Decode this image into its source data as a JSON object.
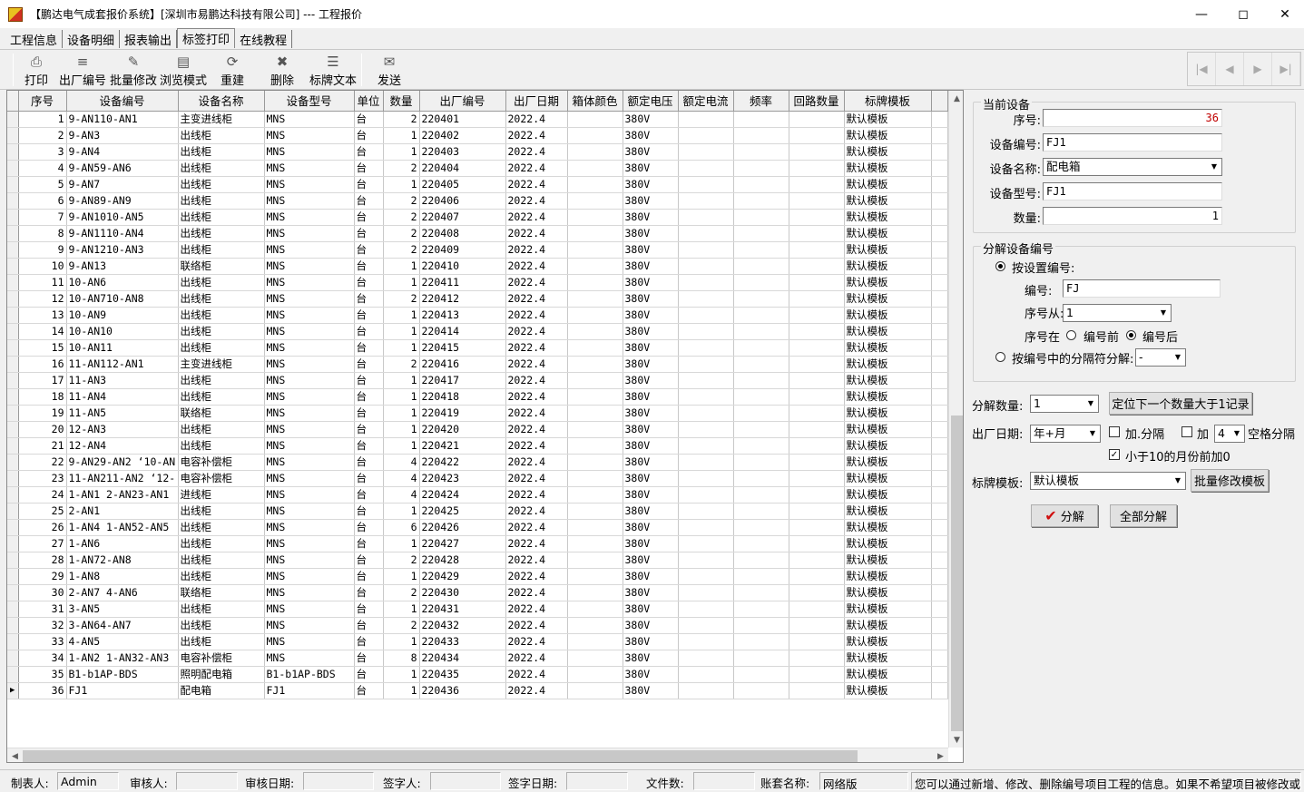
{
  "window": {
    "title": "【鹏达电气成套报价系统】[深圳市易鹏达科技有限公司] --- 工程报价"
  },
  "tabs": [
    "工程信息",
    "设备明细",
    "报表输出",
    "标签打印",
    "在线教程"
  ],
  "toolbar": {
    "buttons": [
      "打印",
      "出厂编号",
      "批量修改",
      "浏览模式",
      "重建",
      "删除",
      "标牌文本",
      "发送"
    ]
  },
  "grid": {
    "columns": [
      "序号",
      "设备编号",
      "设备名称",
      "设备型号",
      "单位",
      "数量",
      "出厂编号",
      "出厂日期",
      "箱体颜色",
      "额定电压",
      "额定电流",
      "频率",
      "回路数量",
      "标牌模板"
    ],
    "rows": [
      [
        "1",
        "9-AN110-AN1",
        "主变进线柜",
        "MNS",
        "台",
        "2",
        "220401",
        "2022.4",
        "",
        "380V",
        "",
        "",
        "",
        "默认模板"
      ],
      [
        "2",
        "9-AN3",
        "出线柜",
        "MNS",
        "台",
        "1",
        "220402",
        "2022.4",
        "",
        "380V",
        "",
        "",
        "",
        "默认模板"
      ],
      [
        "3",
        "9-AN4",
        "出线柜",
        "MNS",
        "台",
        "1",
        "220403",
        "2022.4",
        "",
        "380V",
        "",
        "",
        "",
        "默认模板"
      ],
      [
        "4",
        "9-AN59-AN6",
        "出线柜",
        "MNS",
        "台",
        "2",
        "220404",
        "2022.4",
        "",
        "380V",
        "",
        "",
        "",
        "默认模板"
      ],
      [
        "5",
        "9-AN7",
        "出线柜",
        "MNS",
        "台",
        "1",
        "220405",
        "2022.4",
        "",
        "380V",
        "",
        "",
        "",
        "默认模板"
      ],
      [
        "6",
        "9-AN89-AN9",
        "出线柜",
        "MNS",
        "台",
        "2",
        "220406",
        "2022.4",
        "",
        "380V",
        "",
        "",
        "",
        "默认模板"
      ],
      [
        "7",
        "9-AN1010-AN5",
        "出线柜",
        "MNS",
        "台",
        "2",
        "220407",
        "2022.4",
        "",
        "380V",
        "",
        "",
        "",
        "默认模板"
      ],
      [
        "8",
        "9-AN1110-AN4",
        "出线柜",
        "MNS",
        "台",
        "2",
        "220408",
        "2022.4",
        "",
        "380V",
        "",
        "",
        "",
        "默认模板"
      ],
      [
        "9",
        "9-AN1210-AN3",
        "出线柜",
        "MNS",
        "台",
        "2",
        "220409",
        "2022.4",
        "",
        "380V",
        "",
        "",
        "",
        "默认模板"
      ],
      [
        "10",
        "9-AN13",
        "联络柜",
        "MNS",
        "台",
        "1",
        "220410",
        "2022.4",
        "",
        "380V",
        "",
        "",
        "",
        "默认模板"
      ],
      [
        "11",
        "10-AN6",
        "出线柜",
        "MNS",
        "台",
        "1",
        "220411",
        "2022.4",
        "",
        "380V",
        "",
        "",
        "",
        "默认模板"
      ],
      [
        "12",
        "10-AN710-AN8",
        "出线柜",
        "MNS",
        "台",
        "2",
        "220412",
        "2022.4",
        "",
        "380V",
        "",
        "",
        "",
        "默认模板"
      ],
      [
        "13",
        "10-AN9",
        "出线柜",
        "MNS",
        "台",
        "1",
        "220413",
        "2022.4",
        "",
        "380V",
        "",
        "",
        "",
        "默认模板"
      ],
      [
        "14",
        "10-AN10",
        "出线柜",
        "MNS",
        "台",
        "1",
        "220414",
        "2022.4",
        "",
        "380V",
        "",
        "",
        "",
        "默认模板"
      ],
      [
        "15",
        "10-AN11",
        "出线柜",
        "MNS",
        "台",
        "1",
        "220415",
        "2022.4",
        "",
        "380V",
        "",
        "",
        "",
        "默认模板"
      ],
      [
        "16",
        "11-AN112-AN1",
        "主变进线柜",
        "MNS",
        "台",
        "2",
        "220416",
        "2022.4",
        "",
        "380V",
        "",
        "",
        "",
        "默认模板"
      ],
      [
        "17",
        "11-AN3",
        "出线柜",
        "MNS",
        "台",
        "1",
        "220417",
        "2022.4",
        "",
        "380V",
        "",
        "",
        "",
        "默认模板"
      ],
      [
        "18",
        "11-AN4",
        "出线柜",
        "MNS",
        "台",
        "1",
        "220418",
        "2022.4",
        "",
        "380V",
        "",
        "",
        "",
        "默认模板"
      ],
      [
        "19",
        "11-AN5",
        "联络柜",
        "MNS",
        "台",
        "1",
        "220419",
        "2022.4",
        "",
        "380V",
        "",
        "",
        "",
        "默认模板"
      ],
      [
        "20",
        "12-AN3",
        "出线柜",
        "MNS",
        "台",
        "1",
        "220420",
        "2022.4",
        "",
        "380V",
        "",
        "",
        "",
        "默认模板"
      ],
      [
        "21",
        "12-AN4",
        "出线柜",
        "MNS",
        "台",
        "1",
        "220421",
        "2022.4",
        "",
        "380V",
        "",
        "",
        "",
        "默认模板"
      ],
      [
        "22",
        "9-AN29-AN2 ‘10-AN",
        "电容补偿柜",
        "MNS",
        "台",
        "4",
        "220422",
        "2022.4",
        "",
        "380V",
        "",
        "",
        "",
        "默认模板"
      ],
      [
        "23",
        "11-AN211-AN2 ‘12-",
        "电容补偿柜",
        "MNS",
        "台",
        "4",
        "220423",
        "2022.4",
        "",
        "380V",
        "",
        "",
        "",
        "默认模板"
      ],
      [
        "24",
        "1-AN1 2-AN23-AN1",
        "进线柜",
        "MNS",
        "台",
        "4",
        "220424",
        "2022.4",
        "",
        "380V",
        "",
        "",
        "",
        "默认模板"
      ],
      [
        "25",
        "2-AN1",
        "出线柜",
        "MNS",
        "台",
        "1",
        "220425",
        "2022.4",
        "",
        "380V",
        "",
        "",
        "",
        "默认模板"
      ],
      [
        "26",
        "1-AN4 1-AN52-AN5",
        "出线柜",
        "MNS",
        "台",
        "6",
        "220426",
        "2022.4",
        "",
        "380V",
        "",
        "",
        "",
        "默认模板"
      ],
      [
        "27",
        "1-AN6",
        "出线柜",
        "MNS",
        "台",
        "1",
        "220427",
        "2022.4",
        "",
        "380V",
        "",
        "",
        "",
        "默认模板"
      ],
      [
        "28",
        "1-AN72-AN8",
        "出线柜",
        "MNS",
        "台",
        "2",
        "220428",
        "2022.4",
        "",
        "380V",
        "",
        "",
        "",
        "默认模板"
      ],
      [
        "29",
        "1-AN8",
        "出线柜",
        "MNS",
        "台",
        "1",
        "220429",
        "2022.4",
        "",
        "380V",
        "",
        "",
        "",
        "默认模板"
      ],
      [
        "30",
        "2-AN7 4-AN6",
        "联络柜",
        "MNS",
        "台",
        "2",
        "220430",
        "2022.4",
        "",
        "380V",
        "",
        "",
        "",
        "默认模板"
      ],
      [
        "31",
        "3-AN5",
        "出线柜",
        "MNS",
        "台",
        "1",
        "220431",
        "2022.4",
        "",
        "380V",
        "",
        "",
        "",
        "默认模板"
      ],
      [
        "32",
        "3-AN64-AN7",
        "出线柜",
        "MNS",
        "台",
        "2",
        "220432",
        "2022.4",
        "",
        "380V",
        "",
        "",
        "",
        "默认模板"
      ],
      [
        "33",
        "4-AN5",
        "出线柜",
        "MNS",
        "台",
        "1",
        "220433",
        "2022.4",
        "",
        "380V",
        "",
        "",
        "",
        "默认模板"
      ],
      [
        "34",
        "1-AN2 1-AN32-AN3",
        "电容补偿柜",
        "MNS",
        "台",
        "8",
        "220434",
        "2022.4",
        "",
        "380V",
        "",
        "",
        "",
        "默认模板"
      ],
      [
        "35",
        "B1-b1AP-BDS",
        "照明配电箱",
        "B1-b1AP-BDS",
        "台",
        "1",
        "220435",
        "2022.4",
        "",
        "380V",
        "",
        "",
        "",
        "默认模板"
      ],
      [
        "36",
        "FJ1",
        "配电箱",
        "FJ1",
        "台",
        "1",
        "220436",
        "2022.4",
        "",
        "380V",
        "",
        "",
        "",
        "默认模板"
      ]
    ]
  },
  "panel": {
    "current_title": "当前设备",
    "seq_label": "序号:",
    "seq_value": "36",
    "code_label": "设备编号:",
    "code_value": "FJ1",
    "name_label": "设备名称:",
    "name_value": "配电箱",
    "model_label": "设备型号:",
    "model_value": "FJ1",
    "qty_label": "数量:",
    "qty_value": "1",
    "split_title": "分解设备编号",
    "by_setting_label": "按设置编号:",
    "prefix_label": "编号:",
    "prefix_value": "FJ",
    "from_label": "序号从:",
    "from_value": "1",
    "pos_label": "序号在",
    "before_label": "编号前",
    "after_label": "编号后",
    "by_sep_label": "按编号中的分隔符分解:",
    "sep_value": "-",
    "count_label": "分解数量:",
    "count_value": "1",
    "locate_button": "定位下一个数量大于1记录",
    "date_label": "出厂日期:",
    "date_value": "年+月",
    "add_sep_label": "加.分隔",
    "add_label": "加",
    "add_value": "4",
    "space_label": "空格分隔",
    "month_zero_label": "小于10的月份前加0",
    "template_label": "标牌模板:",
    "template_value": "默认模板",
    "batch_button": "批量修改模板",
    "split_button": "分解",
    "split_all_button": "全部分解"
  },
  "status": {
    "maker_label": "制表人:",
    "maker": "Admin",
    "reviewer_label": "审核人:",
    "review_date_label": "审核日期:",
    "signer_label": "签字人:",
    "sign_date_label": "签字日期:",
    "files_label": "文件数:",
    "account_label": "账套名称:",
    "account": "网络版",
    "message": "您可以通过新增、修改、删除编号项目工程的信息。如果不希望项目被修改或删"
  }
}
